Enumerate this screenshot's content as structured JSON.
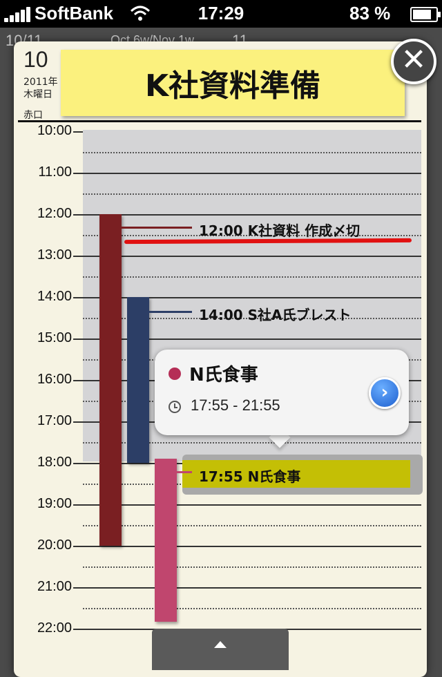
{
  "status_bar": {
    "carrier": "SoftBank",
    "time": "17:29",
    "battery_percent": "83 %"
  },
  "background_calendar": {
    "header_left": "10/11",
    "header_middle": "Oct  6w/Nov  1w",
    "header_right": "11"
  },
  "day_header": {
    "day": "10",
    "year": "2011年 1",
    "weekday": "木曜日",
    "rokuyo": "赤口"
  },
  "sticky_note": {
    "title": "K社資料準備"
  },
  "timeline": {
    "hours": [
      "10:00",
      "11:00",
      "12:00",
      "13:00",
      "14:00",
      "15:00",
      "16:00",
      "17:00",
      "18:00",
      "19:00",
      "20:00",
      "21:00",
      "22:00"
    ]
  },
  "events": [
    {
      "label": "12:00 K社資料 作成〆切",
      "color": "#7a1f22"
    },
    {
      "label": "14:00 S社A氏ブレスト",
      "color": "#2c3e66"
    },
    {
      "label": "17:55 N氏食事",
      "color": "#c0466e"
    }
  ],
  "popover": {
    "title": "N氏食事",
    "time_range": "17:55 - 21:55",
    "accent": "#b52e56"
  },
  "colors": {
    "sticky": "#fbf17e",
    "highlight": "#c4bf05",
    "deadline_underline": "#e11111"
  }
}
